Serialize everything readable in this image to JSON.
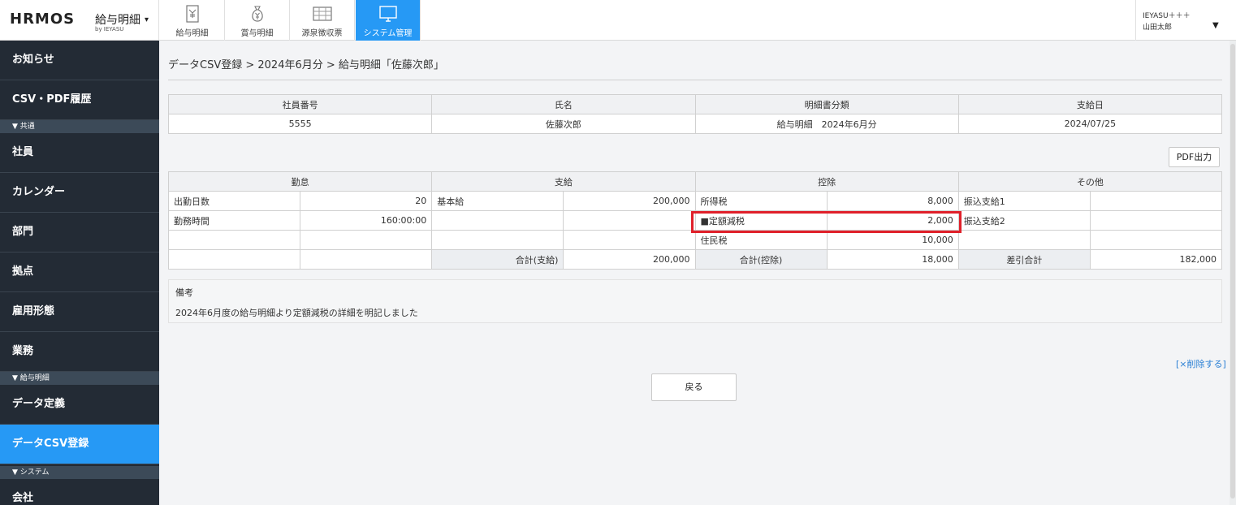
{
  "brand": {
    "logo": "HRMOS",
    "product": "給与明細",
    "byline": "by IEYASU",
    "caret": "▾"
  },
  "nav": {
    "tabs": [
      {
        "label": "給与明細",
        "icon": "envelope-yen-icon"
      },
      {
        "label": "賞与明細",
        "icon": "money-bag-icon"
      },
      {
        "label": "源泉徴収票",
        "icon": "form-sheet-icon"
      },
      {
        "label": "システム管理",
        "icon": "monitor-icon"
      }
    ],
    "active_color": "#2699f5"
  },
  "user": {
    "company": "IEYASU＋＋＋",
    "name": "山田太郎",
    "caret": "▼"
  },
  "sidebar": {
    "items": [
      {
        "label": "お知らせ"
      },
      {
        "label": "CSV・PDF履歴"
      },
      {
        "label": "社員"
      },
      {
        "label": "カレンダー"
      },
      {
        "label": "部門"
      },
      {
        "label": "拠点"
      },
      {
        "label": "雇用形態"
      },
      {
        "label": "業務"
      },
      {
        "label": "データ定義"
      },
      {
        "label": "データCSV登録"
      },
      {
        "label": "会社"
      }
    ],
    "sections": [
      "▼ 共通",
      "▼ 給与明細",
      "▼ システム"
    ]
  },
  "breadcrumb": "データCSV登録 > 2024年6月分 > 給与明細「佐藤次郎」",
  "info_table": {
    "headers": [
      "社員番号",
      "氏名",
      "明細書分類",
      "支給日"
    ],
    "values": [
      "5555",
      "佐藤次郎",
      "給与明細　2024年6月分",
      "2024/07/25"
    ]
  },
  "pdf_button": "PDF出力",
  "pay_table": {
    "headers": [
      "勤怠",
      "支給",
      "控除",
      "その他"
    ],
    "rows": [
      [
        "出勤日数",
        "20",
        "基本給",
        "200,000",
        "所得税",
        "8,000",
        "振込支給1",
        ""
      ],
      [
        "勤務時間",
        "160:00:00",
        "",
        "",
        "■定額減税",
        "2,000",
        "振込支給2",
        ""
      ],
      [
        "",
        "",
        "",
        "",
        "住民税",
        "10,000",
        "",
        ""
      ],
      [
        "",
        "",
        "合計(支給)",
        "200,000",
        "合計(控除)",
        "18,000",
        "差引合計",
        "182,000"
      ]
    ]
  },
  "remarks": {
    "title": "備考",
    "body": "2024年6月度の給与明細より定額減税の詳細を明記しました"
  },
  "delete_link": "[×削除する]",
  "back_button": "戻る",
  "colors": {
    "highlight": "#e0202a",
    "sidebar_bg": "#232b35"
  }
}
